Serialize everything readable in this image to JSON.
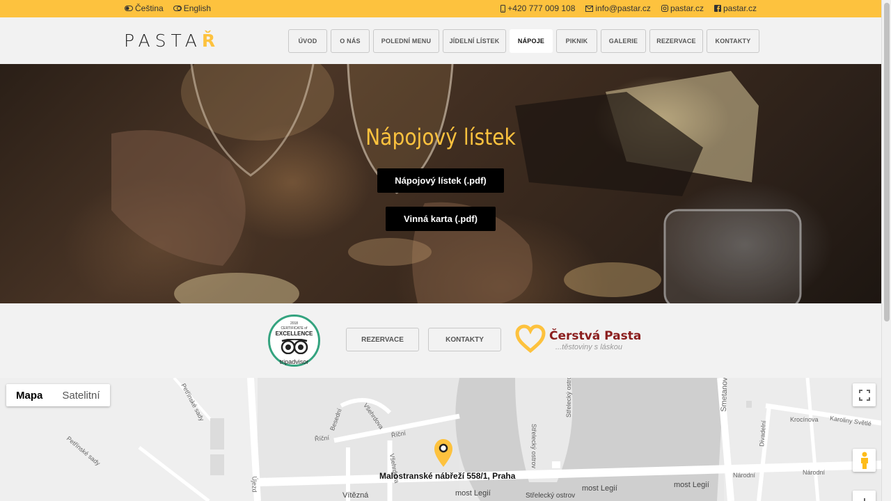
{
  "topbar": {
    "lang_cs": "Čeština",
    "lang_en": "English",
    "phone": "+420 777 009 108",
    "email": "info@pastar.cz",
    "instagram": "pastar.cz",
    "facebook": "pastar.cz"
  },
  "header": {
    "logo_text": "PASTA",
    "logo_accent": "Ř",
    "nav": [
      "ÚVOD",
      "O NÁS",
      "POLEDNÍ MENU",
      "JÍDELNÍ LÍSTEK",
      "NÁPOJE",
      "PIKNIK",
      "GALERIE",
      "REZERVACE",
      "KONTAKTY"
    ],
    "active": "NÁPOJE"
  },
  "hero": {
    "title": "Nápojový lístek",
    "btn_drinks": "Nápojový lístek (.pdf)",
    "btn_wine": "Vinná karta (.pdf)"
  },
  "badges": {
    "ta_year": "2018",
    "ta_cert": "CERTIFICATE of",
    "ta_excellence": "EXCELLENCE",
    "ta_brand": "tripadvisor",
    "btn_reservation": "REZERVACE",
    "btn_contacts": "KONTAKTY",
    "cp_title": "Čerstvá Pasta",
    "cp_sub": "...těstoviny s láskou"
  },
  "map": {
    "btn_map": "Mapa",
    "btn_satellite": "Satelitní",
    "address": "Malostranské nábřeží 558/1, Praha",
    "labels": {
      "petrinske1": "Petřínské sady",
      "petrinske2": "Petřínské sady",
      "besedni": "Besední",
      "vsehrdova": "Všehrdova",
      "ricni1": "Říční",
      "ricni2": "Říční",
      "vsehrdova2": "Všehrdova",
      "strelecky1": "Střelecký ostrov",
      "strelecky2": "Střelecký ostrov",
      "smetanovo": "Smetanovo",
      "krocinova": "Krocínova",
      "karoliny": "Karoliny Světlé",
      "divadelni": "Divadelní",
      "narodni1": "Národní",
      "narodni2": "Národní",
      "vitezna": "Vítězná",
      "legii1": "most Legií",
      "legii2": "most Legií",
      "legii3": "most Legií",
      "strelecky3": "Střelecký ostrov",
      "ujezd": "Újezd"
    }
  }
}
